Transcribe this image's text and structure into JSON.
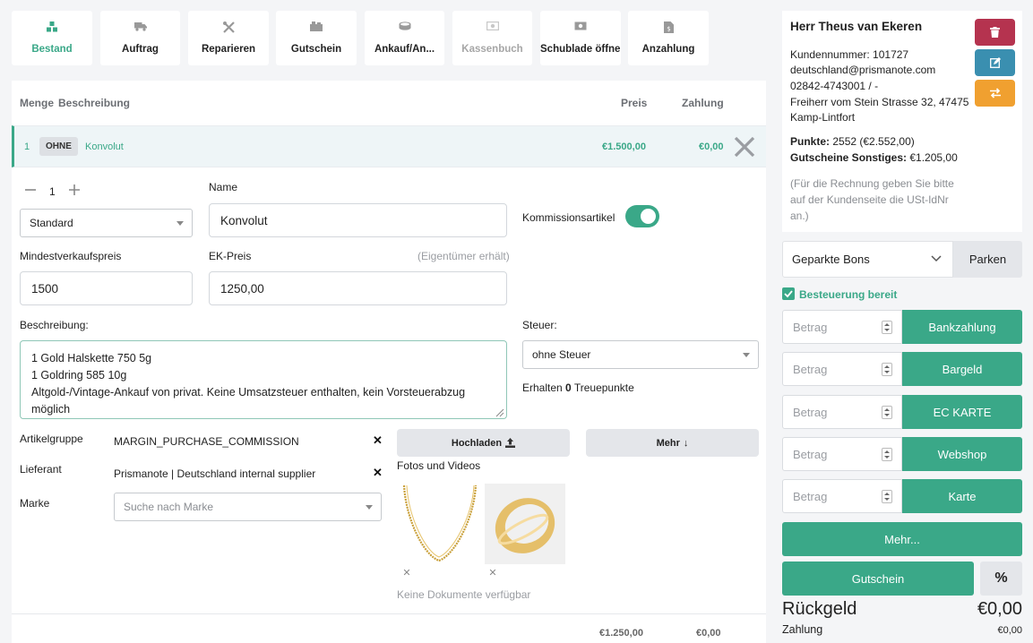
{
  "toolbar": [
    {
      "label": "Bestand",
      "icon": "boxes-icon",
      "state": "active"
    },
    {
      "label": "Auftrag",
      "icon": "truck-icon",
      "state": "normal"
    },
    {
      "label": "Reparieren",
      "icon": "tools-icon",
      "state": "normal"
    },
    {
      "label": "Gutschein",
      "icon": "gift-icon",
      "state": "normal"
    },
    {
      "label": "Ankauf/An...",
      "icon": "gold-bar-icon",
      "state": "normal"
    },
    {
      "label": "Kassenbuch",
      "icon": "cash-icon",
      "state": "disabled"
    },
    {
      "label": "Schublade öffnen",
      "icon": "cash-drawer-icon",
      "state": "normal"
    },
    {
      "label": "Anzahlung",
      "icon": "invoice-icon",
      "state": "normal"
    }
  ],
  "table": {
    "headers": {
      "menge": "Menge",
      "beschreibung": "Beschreibung",
      "preis": "Preis",
      "zahlung": "Zahlung"
    },
    "row": {
      "qty": "1",
      "badge": "OHNE",
      "name": "Konvolut",
      "price": "€1.500,00",
      "payment": "€0,00"
    },
    "footer": {
      "price": "€1.250,00",
      "payment": "€0,00"
    }
  },
  "item": {
    "quantity": "1",
    "type_select": "Standard",
    "name_label": "Name",
    "name_value": "Konvolut",
    "kommission_label": "Kommissionsartikel",
    "kommission_on": true,
    "min_price_label": "Mindestverkaufspreis",
    "min_price_value": "1500",
    "ek_label": "EK-Preis",
    "ek_hint": "(Eigentümer erhält)",
    "ek_value": "1250,00",
    "desc_label": "Beschreibung:",
    "desc_lines": [
      "1 Gold Halskette 750 5g",
      "1 Goldring 585 10g",
      "Altgold-/Vintage-Ankauf von privat. Keine Umsatzsteuer enthalten, kein Vorsteuerabzug",
      "möglich"
    ],
    "tax_label": "Steuer:",
    "tax_value": "ohne Steuer",
    "points_prefix": "Erhalten ",
    "points_value": "0",
    "points_suffix": " Treuepunkte",
    "artikelgruppe_label": "Artikelgruppe",
    "artikelgruppe_value": "MARGIN_PURCHASE_COMMISSION",
    "lieferant_label": "Lieferant",
    "lieferant_value": "Prismanote | Deutschland internal supplier",
    "marke_label": "Marke",
    "marke_placeholder": "Suche nach Marke",
    "upload_label": "Hochladen",
    "more_label": "Mehr",
    "media_label": "Fotos und Videos",
    "no_docs": "Keine Dokumente verfügbar"
  },
  "customer": {
    "name": "Herr Theus van Ekeren",
    "number": "Kundennummer: 101727",
    "email": "deutschland@prismanote.com",
    "phone": "02842-4743001 / -",
    "address1": "Freiherr vom Stein Strasse 32, 47475",
    "address2": "Kamp-Lintfort",
    "points_label": "Punkte:",
    "points_value": " 2552 (€2.552,00)",
    "vouchers_label": "Gutscheine Sonstiges:",
    "vouchers_value": " €1.205,00",
    "note1": "(Für die Rechnung geben Sie bitte",
    "note2": "auf der Kundenseite die USt-IdNr",
    "note3": "an.)"
  },
  "parked": {
    "select": "Geparkte Bons",
    "button": "Parken"
  },
  "tax_ready": "Besteuerung bereit",
  "payments": [
    {
      "placeholder": "Betrag",
      "label": "Bankzahlung"
    },
    {
      "placeholder": "Betrag",
      "label": "Bargeld"
    },
    {
      "placeholder": "Betrag",
      "label": "EC KARTE"
    },
    {
      "placeholder": "Betrag",
      "label": "Webshop"
    },
    {
      "placeholder": "Betrag",
      "label": "Karte"
    }
  ],
  "more_button": "Mehr...",
  "voucher_button": "Gutschein",
  "percent_button": "%",
  "change": {
    "label": "Rückgeld",
    "value": "€0,00"
  },
  "payment_total": {
    "label": "Zahlung",
    "value": "€0,00"
  },
  "colors": {
    "accent": "#3aa888",
    "danger": "#b5334f",
    "info": "#3a8fb0",
    "warning": "#f0a030"
  }
}
